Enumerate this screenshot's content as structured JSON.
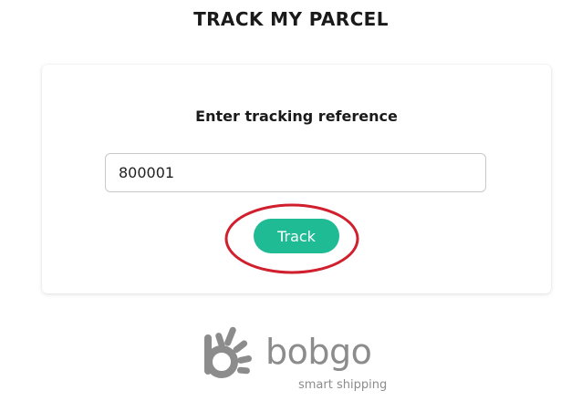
{
  "page": {
    "title": "TRACK MY PARCEL"
  },
  "tracking_form": {
    "heading": "Enter tracking reference",
    "input_value": "800001",
    "button_label": "Track"
  },
  "logo": {
    "wordmark": "bobgo",
    "tagline": "smart shipping",
    "icon": "bobgo-logo-mark-icon"
  },
  "colors": {
    "accent": "#1fbb95",
    "highlight_ring": "#d0202e",
    "logo_gray": "#8c8c8c"
  }
}
